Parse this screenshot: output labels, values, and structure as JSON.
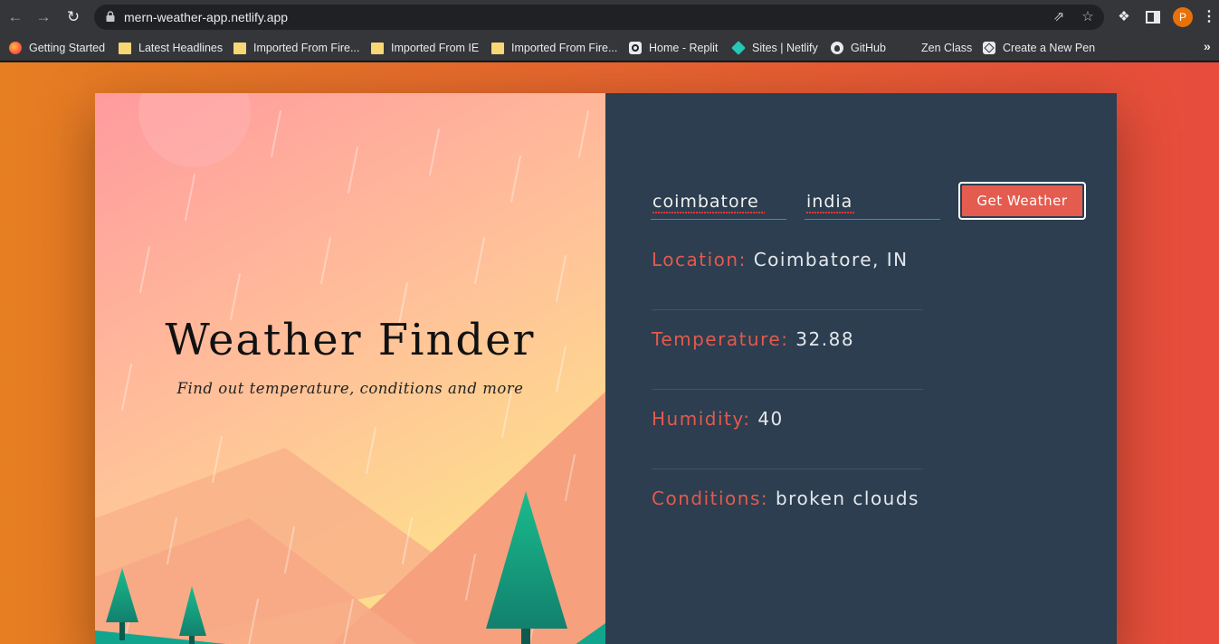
{
  "browser": {
    "url": "mern-weather-app.netlify.app",
    "profile_initial": "P",
    "icons": {
      "back": "arrow-left-icon",
      "forward": "arrow-right-icon",
      "reload": "reload-icon",
      "lock": "lock-icon",
      "share": "share-icon",
      "bookmark": "star-icon",
      "extensions": "puzzle-icon",
      "side_panel": "side-panel-icon",
      "menu": "kebab-menu-icon"
    },
    "bookmarks": [
      {
        "label": "Getting Started",
        "icon": "firefox-icon"
      },
      {
        "label": "Latest Headlines",
        "icon": "folder-icon"
      },
      {
        "label": "Imported From Fire...",
        "icon": "folder-icon"
      },
      {
        "label": "Imported From IE",
        "icon": "folder-icon"
      },
      {
        "label": "Imported From Fire...",
        "icon": "folder-icon"
      },
      {
        "label": "Home - Replit",
        "icon": "replit-icon"
      },
      {
        "label": "Sites | Netlify",
        "icon": "netlify-icon"
      },
      {
        "label": "GitHub",
        "icon": "github-icon"
      },
      {
        "label": "Zen Class",
        "icon": "zen-icon"
      },
      {
        "label": "Create a New Pen",
        "icon": "codepen-icon"
      }
    ],
    "more_bookmarks": "»"
  },
  "app": {
    "title": "Weather Finder",
    "subtitle": "Find out temperature, conditions and more",
    "form": {
      "city_value": "coimbatore",
      "country_value": "india",
      "submit_label": "Get Weather"
    },
    "results": {
      "location_label": "Location:",
      "location_value": "Coimbatore, IN",
      "temperature_label": "Temperature:",
      "temperature_value": "32.88",
      "humidity_label": "Humidity:",
      "humidity_value": "40",
      "conditions_label": "Conditions:",
      "conditions_value": "broken clouds"
    }
  },
  "colors": {
    "page_gradient_start": "#e67e22",
    "page_gradient_end": "#e74c3c",
    "panel_dark": "#2c3e50",
    "accent_red": "#e45c4f",
    "tree_green": "#16a085"
  }
}
